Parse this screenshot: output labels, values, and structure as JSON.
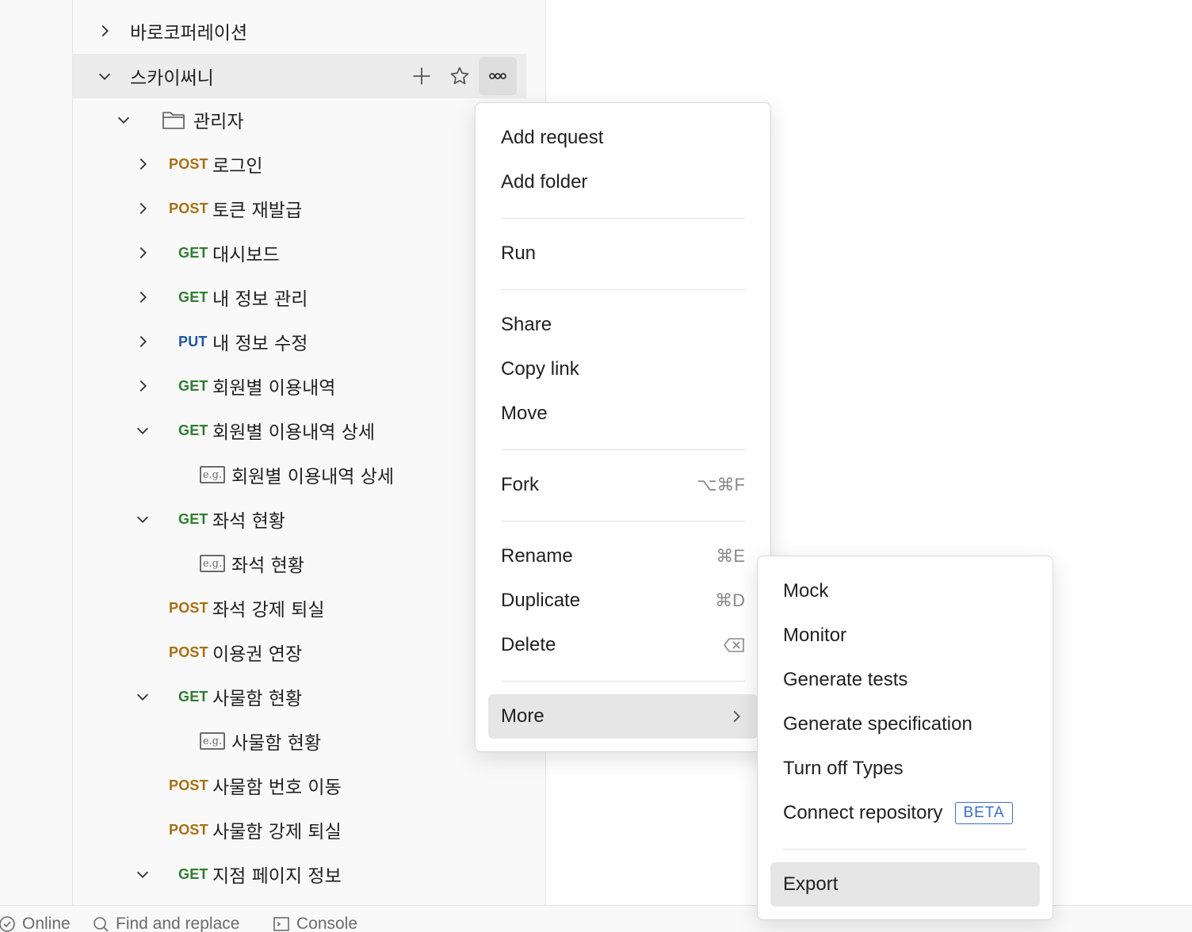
{
  "sidebar": {
    "rows": [
      {
        "label": "바로코퍼레이션"
      },
      {
        "label": "스카이써니"
      },
      {
        "label": "관리자"
      },
      {
        "method": "POST",
        "label": "로그인"
      },
      {
        "method": "POST",
        "label": "토큰 재발급"
      },
      {
        "method": "GET",
        "label": "대시보드"
      },
      {
        "method": "GET",
        "label": "내 정보 관리"
      },
      {
        "method": "PUT",
        "label": "내 정보 수정"
      },
      {
        "method": "GET",
        "label": "회원별 이용내역"
      },
      {
        "method": "GET",
        "label": "회원별 이용내역 상세"
      },
      {
        "example": "e.g.",
        "label": "회원별 이용내역 상세"
      },
      {
        "method": "GET",
        "label": "좌석 현황"
      },
      {
        "example": "e.g.",
        "label": "좌석 현황"
      },
      {
        "method": "POST",
        "label": "좌석 강제 퇴실"
      },
      {
        "method": "POST",
        "label": "이용권 연장"
      },
      {
        "method": "GET",
        "label": "사물함 현황"
      },
      {
        "example": "e.g.",
        "label": "사물함 현황"
      },
      {
        "method": "POST",
        "label": "사물함 번호 이동"
      },
      {
        "method": "POST",
        "label": "사물함 강제 퇴실"
      },
      {
        "method": "GET",
        "label": "지점 페이지 정보"
      }
    ]
  },
  "context_menu": {
    "items": [
      {
        "label": "Add request"
      },
      {
        "label": "Add folder"
      },
      {
        "label": "Run"
      },
      {
        "label": "Share"
      },
      {
        "label": "Copy link"
      },
      {
        "label": "Move"
      },
      {
        "label": "Fork",
        "shortcut": "⌥⌘F"
      },
      {
        "label": "Rename",
        "shortcut": "⌘E"
      },
      {
        "label": "Duplicate",
        "shortcut": "⌘D"
      },
      {
        "label": "Delete",
        "shortcut_icon": "backspace-icon"
      },
      {
        "label": "More"
      }
    ]
  },
  "submenu": {
    "items": [
      {
        "label": "Mock"
      },
      {
        "label": "Monitor"
      },
      {
        "label": "Generate tests"
      },
      {
        "label": "Generate specification"
      },
      {
        "label": "Turn off Types"
      },
      {
        "label": "Connect repository",
        "badge": "BETA"
      },
      {
        "label": "Export"
      }
    ]
  },
  "status_bar": {
    "online": "Online",
    "find_replace": "Find and replace",
    "console": "Console"
  },
  "colors": {
    "post": "#a86e12",
    "get": "#2f7d32",
    "put": "#1c55a8",
    "beta": "#3b6fc4"
  }
}
